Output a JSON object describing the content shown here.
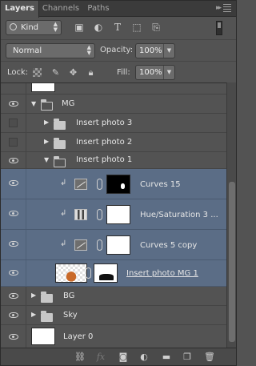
{
  "tabs": [
    {
      "label": "Layers",
      "active": true
    },
    {
      "label": "Channels",
      "active": false
    },
    {
      "label": "Paths",
      "active": false
    }
  ],
  "filter": {
    "kind_label": "Kind",
    "icons": [
      "image-filter-icon",
      "adjustment-filter-icon",
      "type-filter-icon",
      "shape-filter-icon",
      "smart-object-filter-icon"
    ]
  },
  "blend": {
    "mode": "Normal",
    "opacity_label": "Opacity:",
    "opacity_value": "100%"
  },
  "lock": {
    "label": "Lock:",
    "fill_label": "Fill:",
    "fill_value": "100%"
  },
  "layers": [
    {
      "name": "MG",
      "type": "group",
      "expanded": true,
      "visible": true
    },
    {
      "name": "Insert photo 3",
      "type": "group",
      "expanded": false,
      "visible": false
    },
    {
      "name": "Insert photo 2",
      "type": "group",
      "expanded": false,
      "visible": false
    },
    {
      "name": "Insert photo 1",
      "type": "group",
      "expanded": true,
      "visible": true
    },
    {
      "name": "Curves 15",
      "type": "adjustment",
      "visible": true,
      "selected": true
    },
    {
      "name": "Hue/Saturation 3 ...",
      "type": "adjustment",
      "visible": true,
      "selected": true
    },
    {
      "name": "Curves 5 copy",
      "type": "adjustment",
      "visible": true,
      "selected": true
    },
    {
      "name": "Insert photo MG 1",
      "type": "smart-object",
      "visible": true,
      "selected": true
    },
    {
      "name": "BG",
      "type": "group",
      "expanded": false,
      "visible": true
    },
    {
      "name": "Sky",
      "type": "group",
      "expanded": false,
      "visible": true
    },
    {
      "name": "Layer 0",
      "type": "pixel",
      "visible": true
    }
  ],
  "footer_icons": [
    "link-layers-icon",
    "fx-icon",
    "add-mask-icon",
    "new-adjustment-icon",
    "new-group-icon",
    "new-layer-icon",
    "trash-icon"
  ]
}
